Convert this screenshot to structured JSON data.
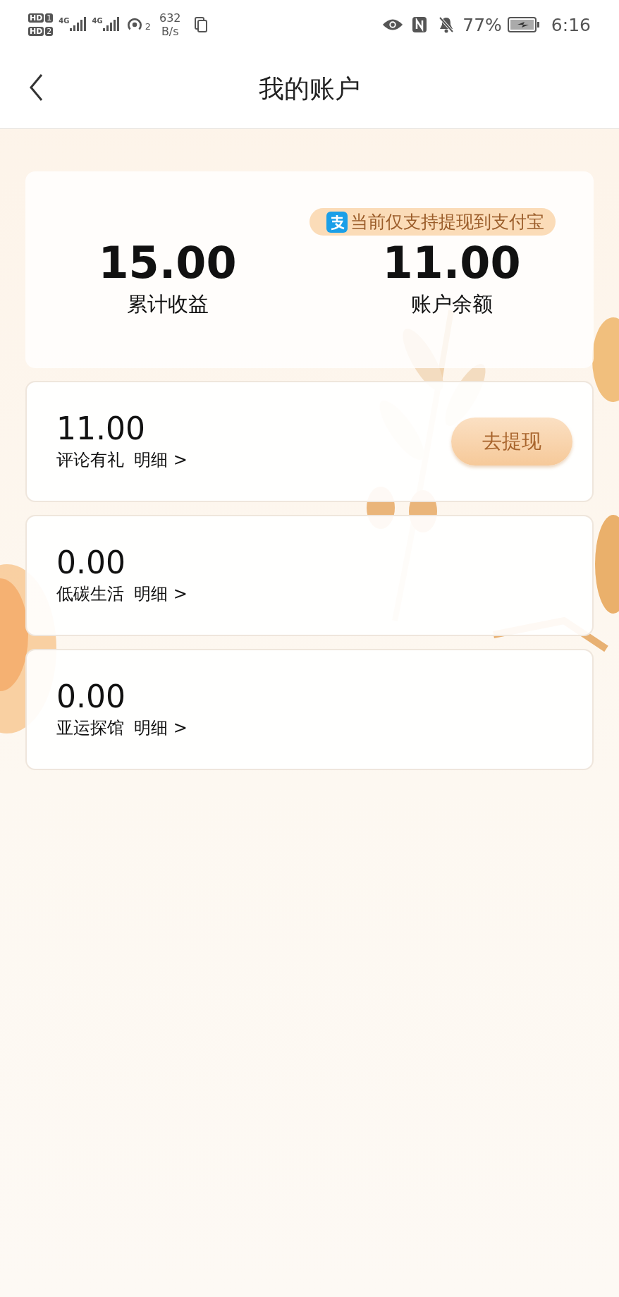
{
  "status_bar": {
    "sims": [
      {
        "label": "HD",
        "slot": "1"
      },
      {
        "label": "HD",
        "slot": "2"
      }
    ],
    "networks": [
      "4G",
      "4G"
    ],
    "hotspot_count": "2",
    "speed_value": "632",
    "speed_unit": "B/s",
    "battery": "77%",
    "time": "6:16"
  },
  "header": {
    "title": "我的账户"
  },
  "summary": {
    "notice": "当前仅支持提现到支付宝",
    "stats": [
      {
        "value": "15.00",
        "label": "累计收益"
      },
      {
        "value": "11.00",
        "label": "账户余额"
      }
    ]
  },
  "accounts": [
    {
      "amount": "11.00",
      "name": "评论有礼",
      "detail": "明细 >",
      "action": "去提现"
    },
    {
      "amount": "0.00",
      "name": "低碳生活",
      "detail": "明细 >"
    },
    {
      "amount": "0.00",
      "name": "亚运探馆",
      "detail": "明细 >"
    }
  ]
}
